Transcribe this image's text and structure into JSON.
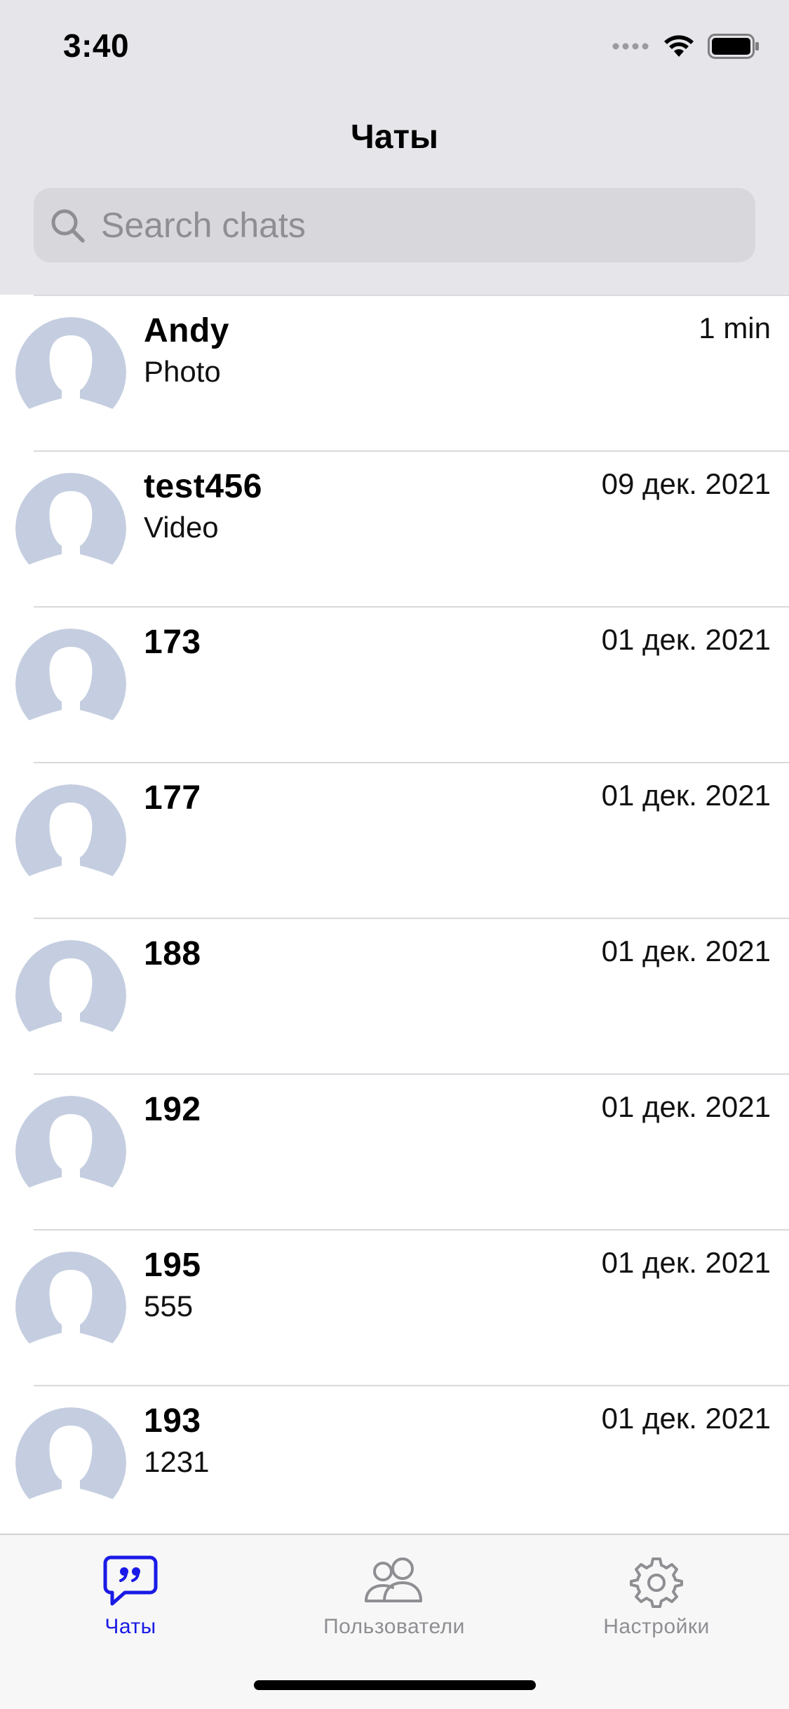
{
  "status_bar": {
    "time": "3:40"
  },
  "nav": {
    "title": "Чаты"
  },
  "search": {
    "placeholder": "Search chats",
    "value": ""
  },
  "chats": [
    {
      "name": "Andy",
      "preview": "Photo",
      "date": "1 min"
    },
    {
      "name": "test456",
      "preview": "Video",
      "date": "09 дек. 2021"
    },
    {
      "name": "173",
      "preview": "",
      "date": "01 дек. 2021"
    },
    {
      "name": "177",
      "preview": "",
      "date": "01 дек. 2021"
    },
    {
      "name": "188",
      "preview": "",
      "date": "01 дек. 2021"
    },
    {
      "name": "192",
      "preview": "",
      "date": "01 дек. 2021"
    },
    {
      "name": "195",
      "preview": "555",
      "date": "01 дек. 2021"
    },
    {
      "name": "193",
      "preview": "1231",
      "date": "01 дек. 2021"
    }
  ],
  "tab_bar": {
    "chats_label": "Чаты",
    "users_label": "Пользователи",
    "settings_label": "Настройки",
    "active": "chats"
  },
  "colors": {
    "accent": "#1a1ae6",
    "header_bg": "#e5e5ea",
    "avatar": "#c5cee0",
    "inactive": "#8e8e93"
  },
  "icons": {
    "search": "search-icon",
    "chats_tab": "chat-bubble-quote-icon",
    "users_tab": "users-icon",
    "settings_tab": "gear-icon",
    "avatar": "person-silhouette-icon"
  }
}
